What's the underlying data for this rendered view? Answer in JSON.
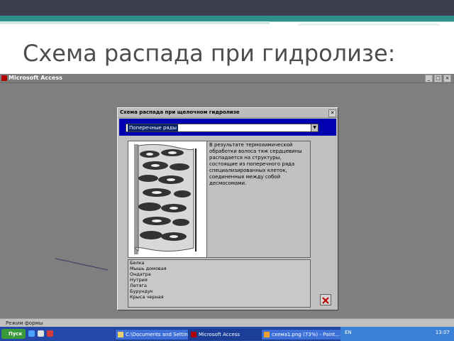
{
  "slide": {
    "title": "Схема распада при гидролизе:"
  },
  "app": {
    "title": "Microsoft Access"
  },
  "dialog": {
    "title": "Схема распада при щелочном гидролизе",
    "close_glyph": "✕",
    "combo_value": "Поперечные ряды",
    "description": "В результате термохимической обработки волоса тяж сердцевины распадается на структуры, состоящие из поперечного ряда специализированных клеток, соединенных между собой десмосомами.",
    "list_items": [
      "Белка",
      "Мышь домовая",
      "Ондатра",
      "Нутрия",
      "Летяга",
      "Бурундук",
      "Крыса черная"
    ]
  },
  "statusbar": {
    "text": "Режим формы"
  },
  "taskbar": {
    "start_label": "Пуск",
    "tasks": [
      {
        "label": "C:\\Documents and Settin..."
      },
      {
        "label": "Microsoft Access"
      },
      {
        "label": "схема1.png (73%) - Paint..."
      }
    ],
    "lang": "EN",
    "time": "13:07"
  },
  "colors": {
    "accent_teal": "#2f8e8a",
    "title_bar": "#3b3e4f",
    "dialog_blue": "#0000b0",
    "taskbar": "#2448a8"
  }
}
